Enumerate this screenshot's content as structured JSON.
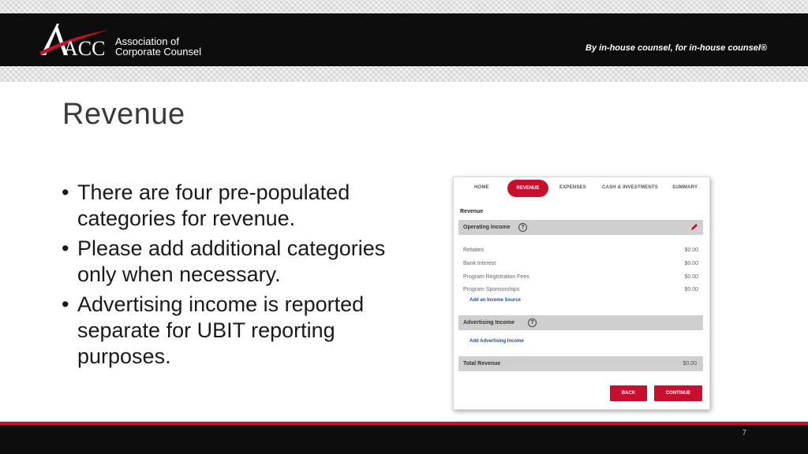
{
  "header": {
    "logo_text": "ACC",
    "logo_line1": "Association of",
    "logo_line2": "Corporate Counsel",
    "tagline": "By in-house counsel, for in-house counsel®",
    "colors": {
      "bar": "#0d0d0d",
      "accent": "#c8102e"
    }
  },
  "slide": {
    "title": "Revenue",
    "bullets": [
      "There are four pre-populated categories for revenue.",
      "Please add additional categories only when necessary.",
      "Advertising income is reported separate for UBIT reporting purposes."
    ],
    "page_number": "7"
  },
  "app": {
    "tabs": [
      "HOME",
      "REVENUE",
      "EXPENSES",
      "CASH & INVESTMENTS",
      "SUMMARY"
    ],
    "active_tab": "REVENUE",
    "section_title": "Revenue",
    "operating_income": {
      "label": "Operating Income",
      "rows": [
        {
          "label": "Rebates",
          "value": "$0.00"
        },
        {
          "label": "Bank Interest",
          "value": "$0.00"
        },
        {
          "label": "Program Registration Fees",
          "value": "$0.00"
        },
        {
          "label": "Program Sponsorships",
          "value": "$0.00"
        }
      ],
      "add_link": "Add an Income Source"
    },
    "advertising_income": {
      "label": "Advertising Income",
      "add_link": "Add Advertising Income"
    },
    "total": {
      "label": "Total Revenue",
      "value": "$0.00"
    },
    "buttons": {
      "back": "BACK",
      "continue": "CONTINUE"
    },
    "icons": {
      "help": "help-circle-icon",
      "edit": "pencil-icon"
    }
  }
}
